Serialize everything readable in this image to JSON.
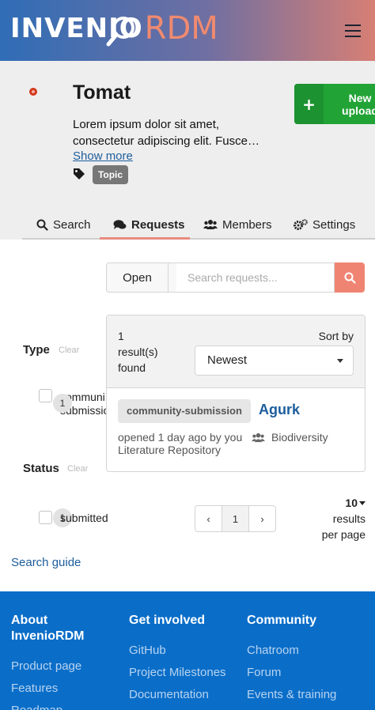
{
  "header": {
    "logo_main": "INVENIO",
    "logo_accent": "RDM"
  },
  "community": {
    "title": "Tomat",
    "description": "Lorem ipsum dolor sit amet, consectetur adipiscing elit. Fusce…",
    "show_more": "Show more",
    "topic": "Topic",
    "new_upload_line1": "New",
    "new_upload_line2": "upload"
  },
  "tabs": [
    {
      "label": "Search"
    },
    {
      "label": "Requests"
    },
    {
      "label": "Members"
    },
    {
      "label": "Settings"
    }
  ],
  "search": {
    "status_button": "Open",
    "placeholder": "Search requests..."
  },
  "facets": {
    "type": {
      "title": "Type",
      "clear": "Clear",
      "items": [
        {
          "label_line1": "communi",
          "label_line2": "submissio",
          "count": "1"
        }
      ]
    },
    "status": {
      "title": "Status",
      "clear": "Clear",
      "items": [
        {
          "label": "submitted",
          "count": "1"
        }
      ]
    }
  },
  "results": {
    "count_line1": "1",
    "count_line2": "result(s)",
    "count_line3": "found",
    "sort_by": "Sort by",
    "sort_value": "Newest",
    "items": [
      {
        "type_badge": "community-submission",
        "title": "Agurk",
        "meta": "opened 1 day ago by you",
        "community": "Biodiversity Literature Repository"
      }
    ]
  },
  "pagination": {
    "prev": "‹",
    "current": "1",
    "next": "›",
    "per_page": "10",
    "per_page_line1": "results",
    "per_page_line2": "per page"
  },
  "search_guide": "Search guide",
  "footer": {
    "col1": {
      "title_line1": "About",
      "title_line2": "InvenioRDM",
      "links": [
        "Product page",
        "Features",
        "Roadmap"
      ]
    },
    "col2": {
      "title": "Get involved",
      "links": [
        "GitHub",
        "Project Milestones",
        "Documentation"
      ]
    },
    "col3": {
      "title": "Community",
      "links": [
        "Chatroom",
        "Forum",
        "Events & training"
      ]
    }
  },
  "colors": {
    "accent": "#f08472",
    "link": "#1c5d9c",
    "footer": "#0a6ec9",
    "new_upload": "#21a336"
  }
}
